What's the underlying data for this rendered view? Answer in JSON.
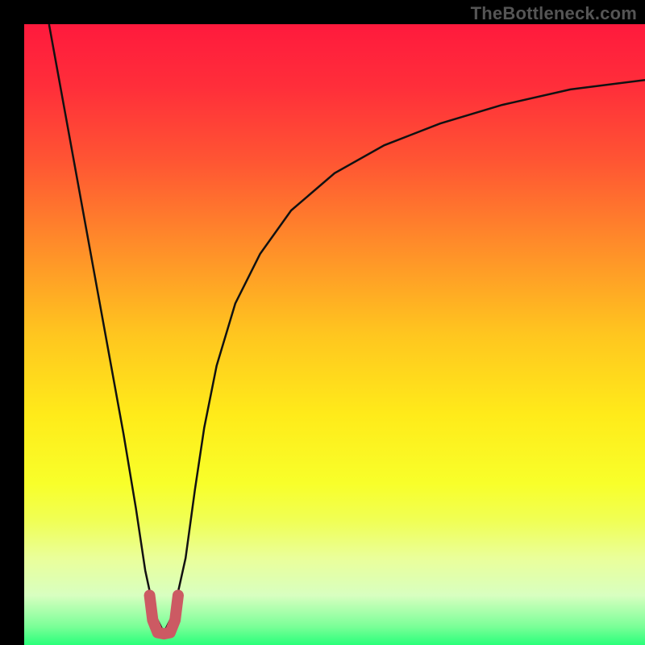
{
  "watermark": "TheBottleneck.com",
  "chart_data": {
    "type": "line",
    "title": "",
    "xlabel": "",
    "ylabel": "",
    "xlim": [
      0,
      100
    ],
    "ylim": [
      0,
      100
    ],
    "grid": false,
    "legend": false,
    "background_gradient": {
      "stops": [
        {
          "offset": 0.0,
          "color": "#ff1a3d"
        },
        {
          "offset": 0.1,
          "color": "#ff2e3a"
        },
        {
          "offset": 0.22,
          "color": "#ff5533"
        },
        {
          "offset": 0.35,
          "color": "#ff8a2a"
        },
        {
          "offset": 0.5,
          "color": "#ffc61f"
        },
        {
          "offset": 0.63,
          "color": "#ffeb1a"
        },
        {
          "offset": 0.74,
          "color": "#f8ff2a"
        },
        {
          "offset": 0.8,
          "color": "#f0ff55"
        },
        {
          "offset": 0.86,
          "color": "#eaff9a"
        },
        {
          "offset": 0.92,
          "color": "#d8ffc0"
        },
        {
          "offset": 0.97,
          "color": "#7bff98"
        },
        {
          "offset": 1.0,
          "color": "#2aff7a"
        }
      ]
    },
    "series": [
      {
        "name": "bottleneck-curve",
        "color": "#111111",
        "stroke_width": 2.5,
        "x": [
          4,
          6,
          8,
          10,
          12,
          14,
          16,
          18,
          19.5,
          21,
          22.5,
          24,
          26,
          27.5,
          29,
          31,
          34,
          38,
          43,
          50,
          58,
          67,
          77,
          88,
          100
        ],
        "y": [
          100,
          89,
          78,
          67,
          56,
          45,
          34,
          22,
          12,
          5,
          2,
          5,
          14,
          25,
          35,
          45,
          55,
          63,
          70,
          76,
          80.5,
          84,
          87,
          89.5,
          91
        ]
      },
      {
        "name": "optimal-region-marker",
        "color": "#cc5a63",
        "stroke_width": 14,
        "linecap": "round",
        "x": [
          20.2,
          20.7,
          21.5,
          22.5,
          23.5,
          24.3,
          24.8
        ],
        "y": [
          8.0,
          4.0,
          2.0,
          1.8,
          2.0,
          4.0,
          8.0
        ]
      }
    ]
  }
}
